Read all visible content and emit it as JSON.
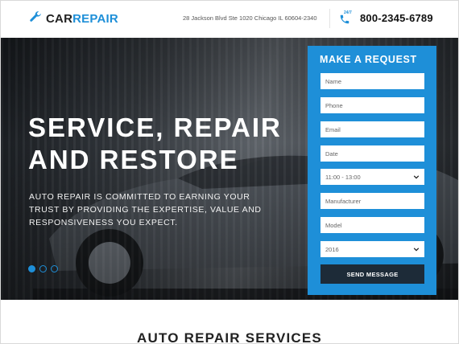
{
  "header": {
    "logo_part1": "CAR",
    "logo_part2": "REPAIR",
    "address": "28 Jackson Blvd Ste 1020 Chicago IL 60604-2340",
    "phone_badge": "24/7",
    "phone": "800-2345-6789"
  },
  "hero": {
    "title_line1": "SERVICE, REPAIR",
    "title_line2": "AND RESTORE",
    "subtitle": "AUTO REPAIR IS COMMITTED TO EARNING YOUR TRUST BY PROVIDING THE EXPERTISE, VALUE AND RESPONSIVENESS YOU EXPECT.",
    "slides": [
      true,
      false,
      false
    ]
  },
  "form": {
    "title": "MAKE A REQUEST",
    "fields": {
      "name": "Name",
      "phone": "Phone",
      "email": "Email",
      "date": "Date",
      "time": "11:00 - 13:00",
      "manufacturer": "Manufacturer",
      "model": "Model",
      "year": "2016"
    },
    "submit": "SEND MESSAGE"
  },
  "services": {
    "heading": "AUTO REPAIR SERVICES"
  },
  "colors": {
    "accent": "#1e8fd8",
    "button_dark": "#1d2b38"
  }
}
